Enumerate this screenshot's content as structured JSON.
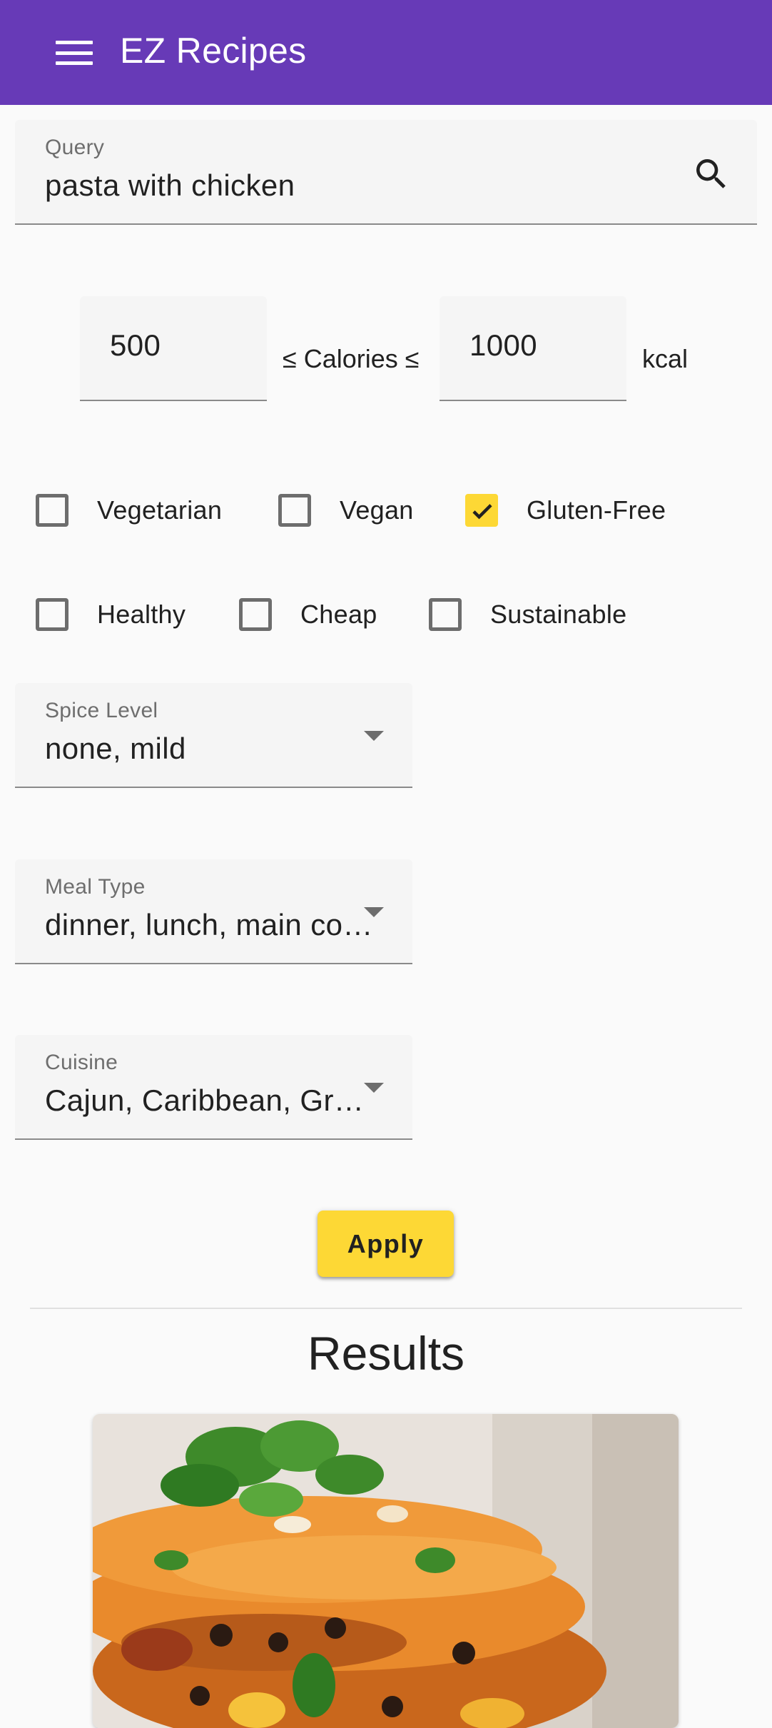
{
  "app": {
    "title": "EZ Recipes",
    "toolbar_color": "#673ab7"
  },
  "search": {
    "label": "Query",
    "value": "pasta with chicken"
  },
  "calories": {
    "min": "500",
    "max": "1000",
    "between_label": "≤ Calories ≤",
    "unit": "kcal"
  },
  "filters": {
    "row1": [
      {
        "label": "Vegetarian",
        "checked": false
      },
      {
        "label": "Vegan",
        "checked": false
      },
      {
        "label": "Gluten-Free",
        "checked": true
      }
    ],
    "row2": [
      {
        "label": "Healthy",
        "checked": false
      },
      {
        "label": "Cheap",
        "checked": false
      },
      {
        "label": "Sustainable",
        "checked": false
      }
    ]
  },
  "spice_level": {
    "label": "Spice Level",
    "value": "none, mild"
  },
  "meal_type": {
    "label": "Meal Type",
    "value": "dinner, lunch, main course"
  },
  "cuisine": {
    "label": "Cuisine",
    "value": "Cajun, Caribbean, Greek"
  },
  "apply": {
    "label": "Apply",
    "color": "#fdd835"
  },
  "results": {
    "title": "Results"
  }
}
